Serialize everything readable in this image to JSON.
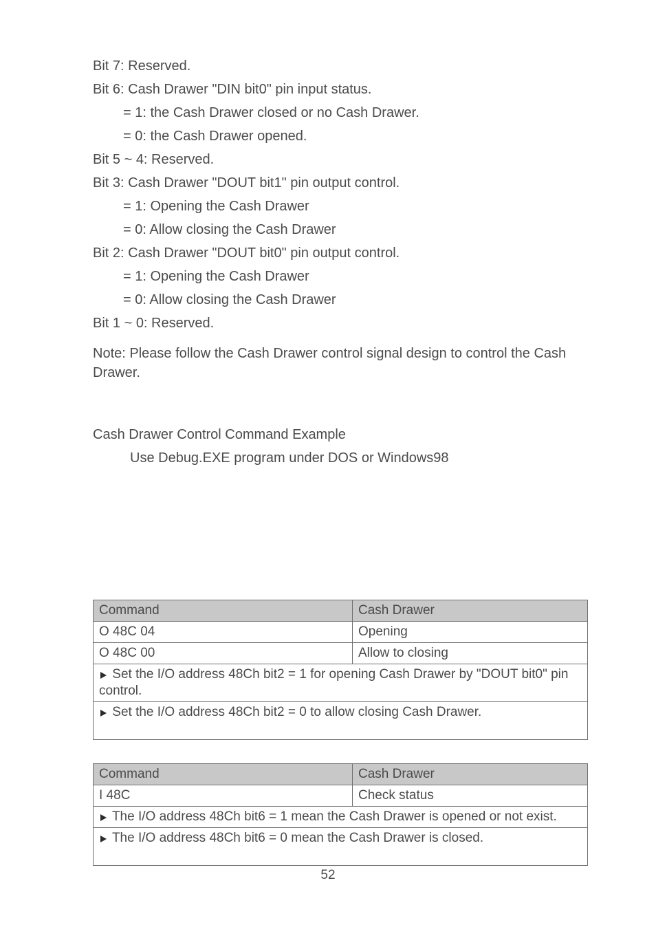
{
  "bits": {
    "bit7_label": "Bit 7: Reserved.",
    "bit6_label": "Bit 6: Cash Drawer \"DIN bit0\" pin input status.",
    "bit6_open": "= 1: the Cash Drawer closed or no Cash Drawer.",
    "bit6_close": "= 0: the Cash Drawer opened.",
    "bit5_4_label": "Bit 5 ~ 4: Reserved.",
    "bit3_label": "Bit 3: Cash Drawer \"DOUT bit1\" pin output control.",
    "bit3_on": "= 1: Opening the Cash Drawer",
    "bit3_off": "= 0: Allow closing the Cash Drawer",
    "bit2_label": "Bit 2: Cash Drawer \"DOUT bit0\" pin output control.",
    "bit2_on": "= 1: Opening the Cash Drawer",
    "bit2_off": "= 0: Allow closing the Cash Drawer",
    "bit1_0_label": "Bit 1 ~ 0: Reserved."
  },
  "note": "Note: Please follow the Cash Drawer control signal design to control the Cash Drawer.",
  "cdc": {
    "heading": "Cash Drawer Control Command Example",
    "desc": "Use Debug.EXE program under DOS or Windows98"
  },
  "table1": {
    "h1": "Command",
    "h2": "Cash Drawer",
    "r1c1": "O 48C 04",
    "r1c2": "Opening",
    "r2c1": "O 48C 00",
    "r2c2": "Allow to closing",
    "step1": "Set the I/O address 48Ch bit2 = 1 for opening Cash Drawer by \"DOUT bit0\" pin control.",
    "step2": "Set the I/O address 48Ch bit2 = 0 to allow closing Cash Drawer."
  },
  "table2": {
    "h1": "Command",
    "h2": "Cash Drawer",
    "r1c1": "I 48C",
    "r1c2": "Check status",
    "step1": "The I/O address 48Ch bit6 = 1 mean the Cash Drawer is opened or not exist.",
    "step2": "The I/O address 48Ch bit6 = 0 mean the Cash Drawer is closed."
  },
  "page_number": "52"
}
